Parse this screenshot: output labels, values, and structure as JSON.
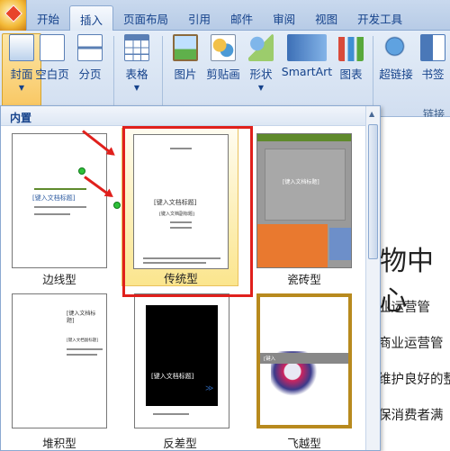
{
  "tabs": [
    "开始",
    "插入",
    "页面布局",
    "引用",
    "邮件",
    "审阅",
    "视图",
    "开发工具"
  ],
  "active_tab": "插入",
  "ribbon": {
    "cover": "封面",
    "blank_page": "空白页",
    "page_break": "分页",
    "table": "表格",
    "picture": "图片",
    "clipart": "剪贴画",
    "shapes": "形状",
    "smartart": "SmartArt",
    "chart": "图表",
    "hyperlink": "超链接",
    "bookmark": "书签",
    "group_links": "链接"
  },
  "gallery": {
    "title": "内置",
    "items": [
      {
        "name": "边线型",
        "placeholder": "[键入文档标题]"
      },
      {
        "name": "传统型",
        "placeholder": "[键入文档标题]",
        "sub": "[键入文档副标题]"
      },
      {
        "name": "瓷砖型",
        "placeholder": "[键入文档标题]"
      },
      {
        "name": "堆积型",
        "placeholder": "[键入文档标题]",
        "sub": "[键入文档副标题]"
      },
      {
        "name": "反差型",
        "placeholder": "[键入文档标题]"
      },
      {
        "name": "飞越型",
        "placeholder": "[键入"
      }
    ]
  },
  "document": {
    "heading_fragment": "物中心",
    "lines": [
      "业运营管",
      "商业运营管",
      "维护良好的整",
      "保消费者满"
    ]
  },
  "colors": {
    "highlight_border": "#e0201c",
    "tile_gray": "#9a9a9a",
    "tile_orange": "#e9792f",
    "tile_blue": "#6d8fc9",
    "tile_green": "#5f8a2c"
  }
}
